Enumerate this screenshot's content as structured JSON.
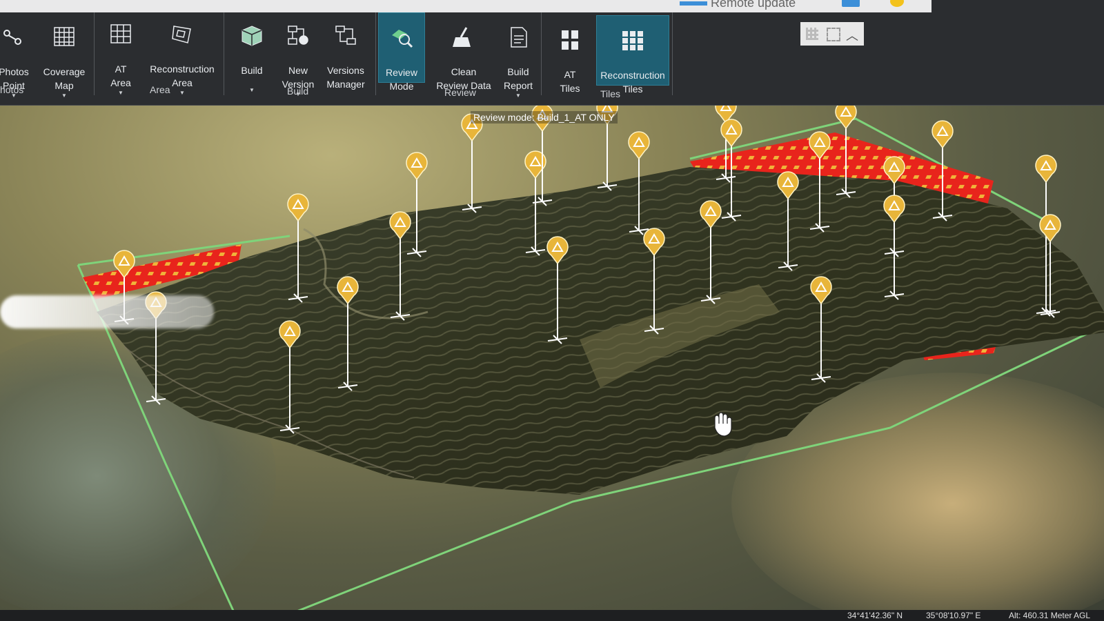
{
  "ribbon": {
    "buttons": {
      "photos_point": "Photos\nPoint",
      "coverage_map": "Coverage\nMap",
      "at_area": "AT\nArea",
      "reconstruction_area": "Reconstruction\nArea",
      "build": "Build",
      "new_version": "New\nVersion",
      "versions_manager": "Versions\nManager",
      "review_mode": "Review\nMode",
      "clean_review_data": "Clean\nReview Data",
      "build_report": "Build\nReport",
      "at_tiles": "AT\nTiles",
      "reconstruction_tiles": "Reconstruction\nTiles"
    },
    "groups": {
      "photos": "hotos",
      "area": "Area",
      "build": "Build",
      "review": "Review",
      "tiles": "Tiles"
    }
  },
  "titlebar": {
    "partial_text": "Remote update"
  },
  "viewport": {
    "review_label": "Review mode: Build_1_AT ONLY"
  },
  "statusbar": {
    "latitude": "34°41'42.36\" N",
    "longitude": "35°08'10.97\" E",
    "altitude": "Alt: 460.31 Meter AGL"
  },
  "icons": [
    "photos-point-icon",
    "coverage-map-icon",
    "at-area-icon",
    "reconstruction-area-icon",
    "build-icon",
    "new-version-icon",
    "versions-manager-icon",
    "review-mode-icon",
    "clean-review-data-icon",
    "build-report-icon",
    "at-tiles-icon",
    "reconstruction-tiles-icon",
    "control-point-marker-icon",
    "hand-cursor-icon"
  ],
  "colors": {
    "ribbon_bg": "#2b2d30",
    "active_button": "#1f5f73",
    "marker": "#e8b53a",
    "boundary": "#7fd37a",
    "error_tiles": "#e8241c"
  }
}
